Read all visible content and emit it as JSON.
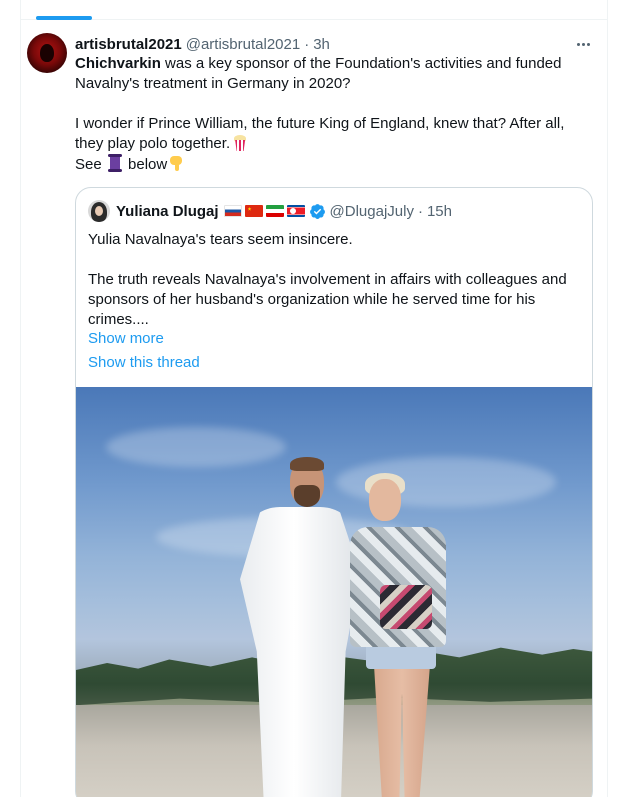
{
  "tweet": {
    "display_name": "artisbrutal2021",
    "handle": "@artisbrutal2021",
    "time": "3h",
    "separator": "·",
    "bold_lead": "Chichvarkin",
    "line1_rest": " was a key sponsor of the Foundation's activities and funded Navalny's treatment in Germany in 2020?",
    "line2": "I wonder if Prince William, the future King of England, knew that?  After all, they play polo together.",
    "see_prefix": "See ",
    "see_suffix": " below",
    "icons": {
      "more": "more-options-icon",
      "popcorn": "popcorn-emoji",
      "scroll": "scroll-emoji",
      "pointer": "pointing-down-emoji"
    }
  },
  "quote": {
    "display_name": "Yuliana Dlugaj",
    "flags": [
      "flag-russia",
      "flag-china",
      "flag-iran",
      "flag-north-korea"
    ],
    "handle": "@DlugajJuly",
    "separator": "·",
    "time": "15h",
    "text1": "Yulia Navalnaya's tears seem insincere.",
    "text2": "The truth reveals Navalnaya's involvement in affairs with colleagues and sponsors of her husband's organization while he served time for his crimes....",
    "show_more": "Show more",
    "show_thread": "Show this thread",
    "colors": {
      "link": "#1d9bf0",
      "verified": "#1d9bf0"
    }
  },
  "colors": {
    "accent": "#1d9bf0",
    "text": "#0f1419",
    "muted": "#536471",
    "border": "#cfd9de"
  }
}
